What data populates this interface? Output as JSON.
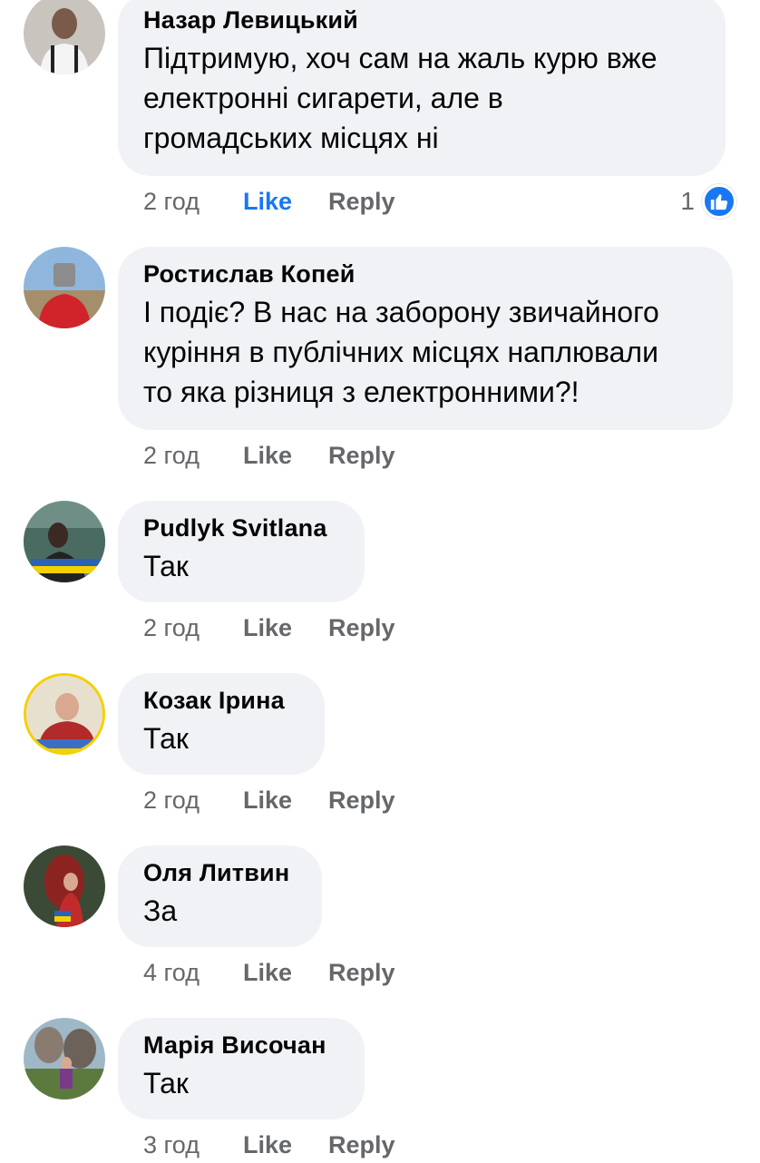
{
  "comments": [
    {
      "author": "Назар Левицький",
      "lines": [
        "Підтримую, хоч сам на жаль курю вже",
        "електронні сигарети, але в",
        "громадських місцях ні"
      ],
      "time": "2 год",
      "like_label": "Like",
      "reply_label": "Reply",
      "liked": true,
      "reaction_count": "1"
    },
    {
      "author": "Ростислав Копей",
      "lines": [
        "І подіє? В нас на заборону звичайного",
        "куріння в публічних місцях наплювали",
        "то яка різниця з електронними?!"
      ],
      "time": "2 год",
      "like_label": "Like",
      "reply_label": "Reply"
    },
    {
      "author": "Pudlyk Svitlana",
      "lines": [
        "Так"
      ],
      "time": "2 год",
      "like_label": "Like",
      "reply_label": "Reply"
    },
    {
      "author": "Козак Ірина",
      "lines": [
        "Так"
      ],
      "time": "2 год",
      "like_label": "Like",
      "reply_label": "Reply"
    },
    {
      "author": "Оля Литвин",
      "lines": [
        "За"
      ],
      "time": "4 год",
      "like_label": "Like",
      "reply_label": "Reply"
    },
    {
      "author": "Марія Височан",
      "lines": [
        "Так"
      ],
      "time": "3 год",
      "like_label": "Like",
      "reply_label": "Reply"
    }
  ],
  "colors": {
    "bubble": "#f0f2f5",
    "accent": "#1877f2",
    "muted": "#65676b"
  },
  "icons": {
    "reaction": "thumbs-up-icon"
  }
}
